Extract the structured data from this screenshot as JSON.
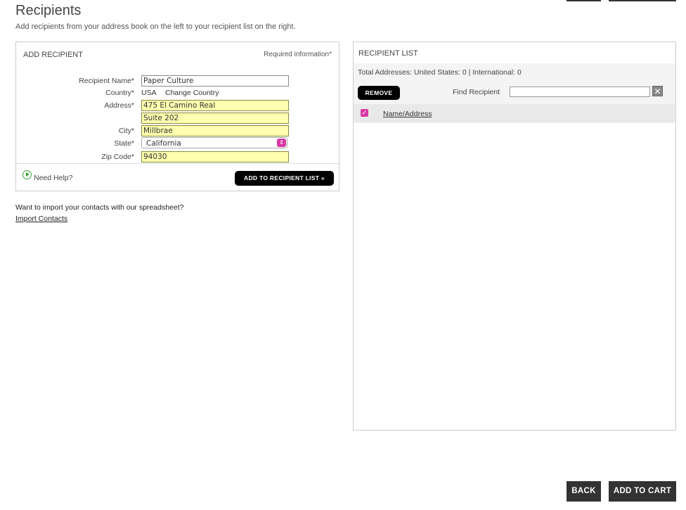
{
  "page": {
    "title": "Recipients",
    "subtitle": "Add recipients from your address book on the left to your recipient list on the right."
  },
  "add_recipient": {
    "heading": "ADD RECIPIENT",
    "required_note": "Required information*",
    "labels": {
      "name": "Recipient Name*",
      "country": "Country*",
      "address": "Address*",
      "city": "City*",
      "state": "State*",
      "zip": "Zip Code*"
    },
    "values": {
      "name": "Paper Culture",
      "country": "USA",
      "address1": "475 El Camino Real",
      "address2": "Suite 202",
      "city": "Millbrae",
      "state": "California",
      "zip": "94030"
    },
    "change_country": "Change Country",
    "need_help": "Need Help?",
    "add_button": "ADD TO RECIPIENT LIST »"
  },
  "import": {
    "question": "Want to import your contacts with our spreadsheet?",
    "link": "Import Contacts"
  },
  "recipient_list": {
    "heading": "RECIPIENT LIST",
    "totals": "Total Addresses: United States: 0 | International: 0",
    "remove_button": "REMOVE",
    "find_label": "Find Recipient",
    "find_value": "",
    "column_name": "Name/Address"
  },
  "footer": {
    "back": "BACK",
    "add_to_cart": "ADD TO CART"
  },
  "colors": {
    "accent": "#d83aa5",
    "filled_field": "#ffffb0"
  }
}
